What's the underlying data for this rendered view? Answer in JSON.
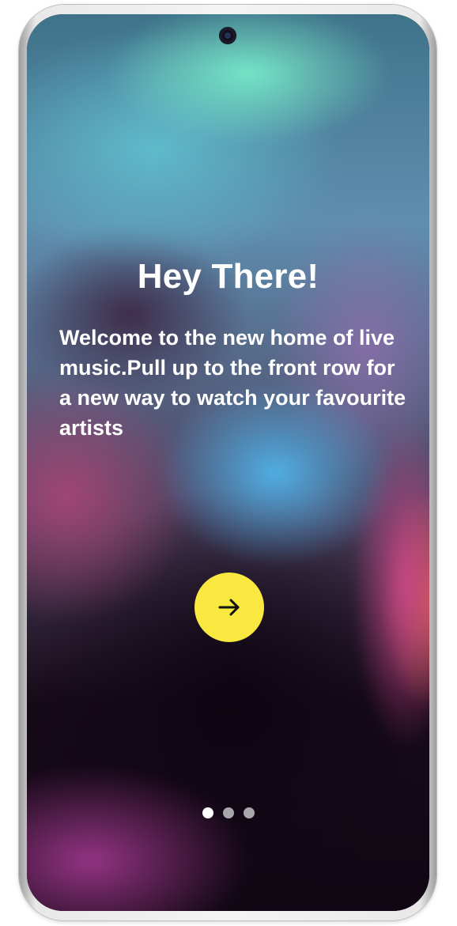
{
  "onboarding": {
    "title": "Hey There!",
    "message": "Welcome to the new home of live music.Pull up to the front row for a new way to watch your favourite artists",
    "next_button_icon": "arrow-right-icon",
    "page_indicator": {
      "total": 3,
      "current": 1
    }
  },
  "colors": {
    "accent": "#f9e83f",
    "text": "#ffffff",
    "dot_active": "#ffffff",
    "dot_inactive": "#a9a7ab"
  }
}
